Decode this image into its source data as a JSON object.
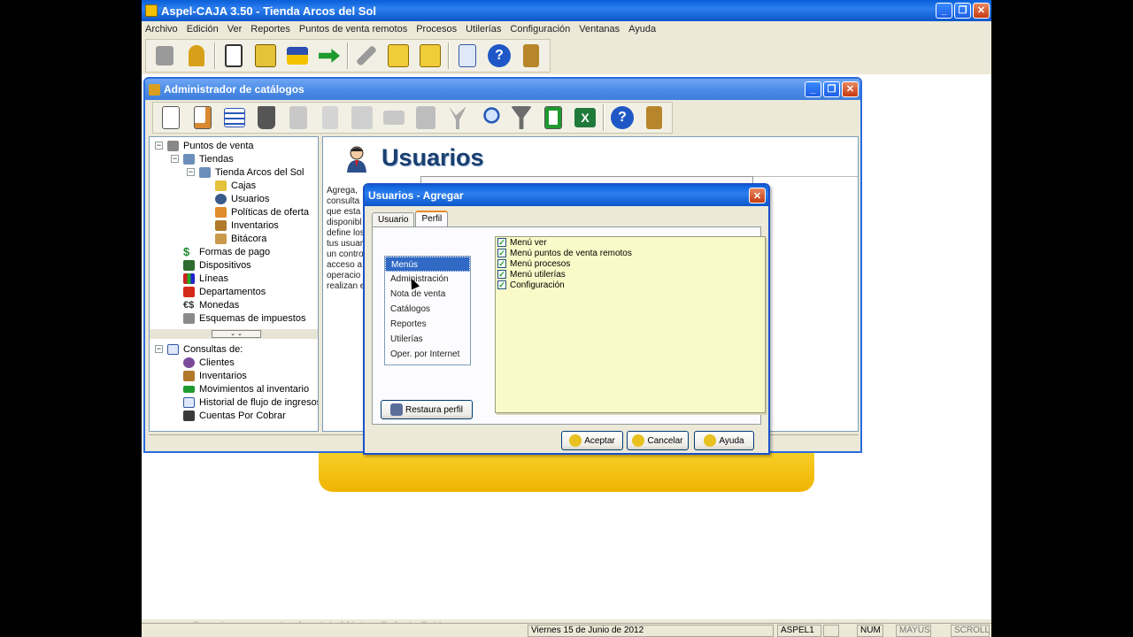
{
  "app": {
    "title": "Aspel-CAJA 3.50 - Tienda Arcos del Sol",
    "window_buttons": {
      "minimize": "_",
      "restore": "❐",
      "close": "✕"
    }
  },
  "menubar": [
    "Archivo",
    "Edición",
    "Ver",
    "Reportes",
    "Puntos de venta remotos",
    "Procesos",
    "Utilerías",
    "Configuración",
    "Ventanas",
    "Ayuda"
  ],
  "main_toolbar": [
    "lock-open-icon",
    "padlock-icon",
    "notebook-icon",
    "cash-register-icon",
    "card-icon",
    "transfer-arrows-icon",
    "tools-icon",
    "folders-icon",
    "folders-transfer-icon",
    "calculator-icon",
    "help-icon",
    "exit-door-icon"
  ],
  "admin": {
    "title": "Administrador de catálogos",
    "toolbar": [
      "new-document-icon",
      "edit-icon",
      "list-icon",
      "delete-icon",
      "tag-icon",
      "doc-icon",
      "docs-icon",
      "handshake-icon",
      "abacus-icon",
      "merge-icon",
      "search-icon",
      "filter-icon",
      "refresh-icon",
      "excel-icon",
      "help-icon",
      "exit-door-icon"
    ],
    "tree": {
      "puntos": "Puntos de venta",
      "tiendas": "Tiendas",
      "tienda": "Tienda Arcos del Sol",
      "cajas": "Cajas",
      "usuarios": "Usuarios",
      "politicas": "Políticas de oferta",
      "inventarios": "Inventarios",
      "bitacora": "Bitácora",
      "formas": "Formas de pago",
      "dispositivos": "Dispositivos",
      "lineas": "Líneas",
      "departamentos": "Departamentos",
      "monedas": "Monedas",
      "esquemas": "Esquemas de impuestos",
      "consultas": "Consultas de:",
      "clientes": "Clientes",
      "c_inventarios": "Inventarios",
      "movimientos": "Movimientos al inventario",
      "historial": "Historial de flujo de ingresos",
      "cuentas": "Cuentas Por Cobrar"
    },
    "content": {
      "title": "Usuarios",
      "desc": [
        "Agrega,",
        "consulta",
        "que esta",
        "disponibl",
        "define los",
        "tus usuar",
        "un contro",
        "acceso a",
        "operacio",
        "realizan e"
      ]
    }
  },
  "dialog": {
    "title": "Usuarios - Agregar",
    "close": "✕",
    "tabs": [
      "Usuario",
      "Perfil"
    ],
    "list": [
      "Menús",
      "Administración",
      "Nota de venta",
      "Catálogos",
      "Reportes",
      "Utilerías",
      "Oper. por Internet"
    ],
    "checks": [
      {
        "label": "Menú ver",
        "checked": true
      },
      {
        "label": "Menú puntos de venta remotos",
        "checked": true
      },
      {
        "label": "Menú procesos",
        "checked": true
      },
      {
        "label": "Menú utilerías",
        "checked": true
      },
      {
        "label": "Configuración",
        "checked": true
      }
    ],
    "restaura": "Restaura perfil",
    "aceptar": "Aceptar",
    "cancelar": "Cancelar",
    "ayuda": "Ayuda"
  },
  "footer": "Derechos reservados Aspel de México, S. A. de C. V.",
  "status": {
    "date": "Viernes 15 de Junio de 2012",
    "user": "ASPEL1",
    "num": "NUM",
    "mayus": "MAYUS",
    "scroll": "SCROLL"
  }
}
